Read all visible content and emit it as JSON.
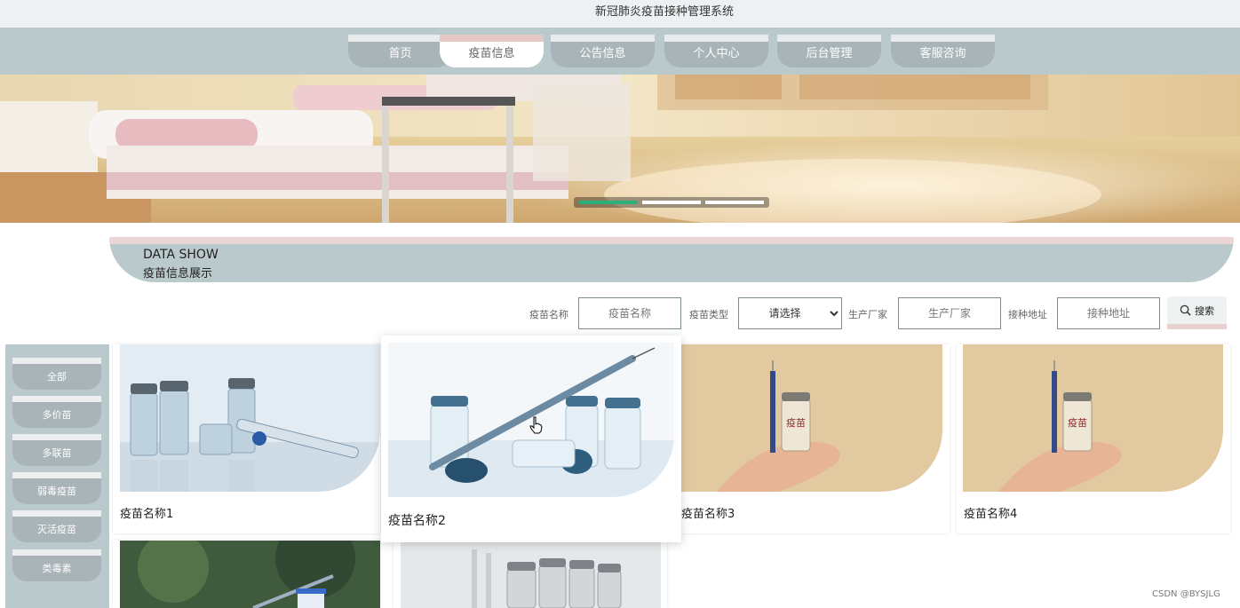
{
  "site": {
    "title": "新冠肺炎疫苗接种管理系统"
  },
  "nav": {
    "items": [
      {
        "label": "首页"
      },
      {
        "label": "疫苗信息"
      },
      {
        "label": "公告信息"
      },
      {
        "label": "个人中心"
      },
      {
        "label": "后台管理"
      },
      {
        "label": "客服咨询"
      }
    ],
    "active": "疫苗信息"
  },
  "section": {
    "en": "DATA SHOW",
    "cn": "疫苗信息展示"
  },
  "filters": {
    "name_label": "疫苗名称",
    "name_placeholder": "疫苗名称",
    "type_label": "疫苗类型",
    "type_selected": "请选择",
    "maker_label": "生产厂家",
    "maker_placeholder": "生产厂家",
    "address_label": "接种地址",
    "address_placeholder": "接种地址",
    "search_label": "搜索"
  },
  "categories": [
    {
      "label": "全部"
    },
    {
      "label": "多价苗"
    },
    {
      "label": "多联苗"
    },
    {
      "label": "弱毒疫苗"
    },
    {
      "label": "灭活疫苗"
    },
    {
      "label": "类毒素"
    }
  ],
  "cards": [
    {
      "name": "疫苗名称1"
    },
    {
      "name": "疫苗名称2"
    },
    {
      "name": "疫苗名称3"
    },
    {
      "name": "疫苗名称4"
    }
  ],
  "vial_label": "疫苗",
  "watermark": "CSDN @BYSJLG",
  "colors": {
    "nav_bg": "#bac9cc",
    "tab": "#a8b4b7",
    "accent_pink": "#e5c8c6",
    "carousel_active": "#2bb07a"
  },
  "icons": {
    "search": "search-icon",
    "cursor": "hand-pointer-icon"
  }
}
